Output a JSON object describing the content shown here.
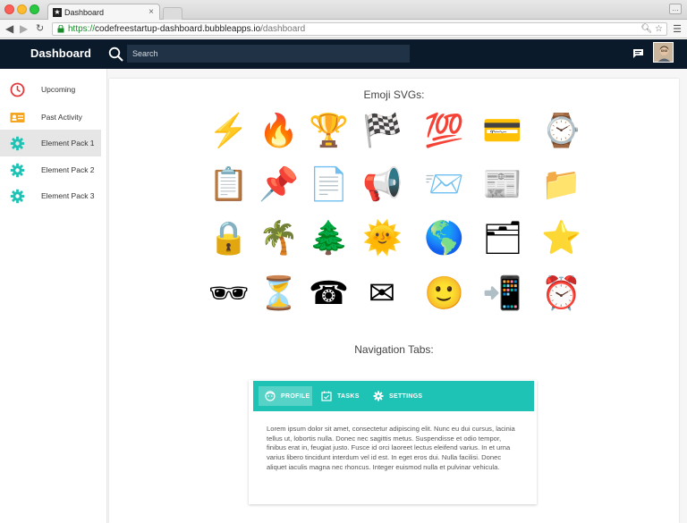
{
  "browser": {
    "tab_title": "Dashboard",
    "tab_close": "×",
    "url_scheme": "https://",
    "url_host": "codefreestartup-dashboard.bubbleapps.io",
    "url_path": "/dashboard"
  },
  "header": {
    "brand": "Dashboard",
    "search_placeholder": "Search"
  },
  "sidebar": {
    "items": [
      {
        "label": "Upcoming",
        "icon": "clock-icon",
        "color": "#e0393e"
      },
      {
        "label": "Past Activity",
        "icon": "id-card-icon",
        "color": "#f4a623"
      },
      {
        "label": "Element Pack 1",
        "icon": "gear-icon",
        "color": "#1ec3b5"
      },
      {
        "label": "Element Pack 2",
        "icon": "gear-icon",
        "color": "#1ec3b5"
      },
      {
        "label": "Element Pack 3",
        "icon": "gear-icon",
        "color": "#1ec3b5"
      }
    ]
  },
  "main": {
    "emoji_title": "Emoji SVGs:",
    "emojis": [
      {
        "glyph": "⚡",
        "name": "lightning-icon"
      },
      {
        "glyph": "🔥",
        "name": "fire-icon"
      },
      {
        "glyph": "🏆",
        "name": "trophy-icon"
      },
      {
        "glyph": "🏁",
        "name": "checkered-flag-icon"
      },
      {
        "glyph": "💯",
        "name": "hundred-points-icon"
      },
      {
        "glyph": "💳",
        "name": "credit-card-icon"
      },
      {
        "glyph": "⌚",
        "name": "watch-icon"
      },
      {
        "glyph": "📋",
        "name": "clipboard-icon"
      },
      {
        "glyph": "📌",
        "name": "pushpin-icon"
      },
      {
        "glyph": "📄",
        "name": "document-icon"
      },
      {
        "glyph": "📢",
        "name": "megaphone-icon"
      },
      {
        "glyph": "📨",
        "name": "incoming-envelope-icon"
      },
      {
        "glyph": "📰",
        "name": "newspaper-icon"
      },
      {
        "glyph": "📁",
        "name": "folder-icon"
      },
      {
        "glyph": "🔒",
        "name": "lock-icon"
      },
      {
        "glyph": "🌴",
        "name": "palm-tree-icon"
      },
      {
        "glyph": "🌲",
        "name": "evergreen-tree-icon"
      },
      {
        "glyph": "🌞",
        "name": "sun-icon"
      },
      {
        "glyph": "🌎",
        "name": "globe-icon"
      },
      {
        "glyph": "🗂",
        "name": "card-box-icon"
      },
      {
        "glyph": "⭐",
        "name": "star-icon"
      },
      {
        "glyph": "🕶",
        "name": "sunglasses-icon"
      },
      {
        "glyph": "⏳",
        "name": "hourglass-icon"
      },
      {
        "glyph": "☎",
        "name": "telephone-icon"
      },
      {
        "glyph": "✉",
        "name": "envelope-icon"
      },
      {
        "glyph": "🙂",
        "name": "smiley-icon"
      },
      {
        "glyph": "📲",
        "name": "mobile-arrow-icon"
      },
      {
        "glyph": "⏰",
        "name": "alarm-clock-icon"
      }
    ],
    "tabs_title": "Navigation Tabs:",
    "tabs": [
      {
        "label": "PROFILE",
        "icon": "face-icon",
        "active": true
      },
      {
        "label": "TASKS",
        "icon": "calendar-check-icon",
        "active": false
      },
      {
        "label": "SETTINGS",
        "icon": "gear-icon",
        "active": false
      }
    ],
    "tab_body": "Lorem ipsum dolor sit amet, consectetur adipiscing elit. Nunc eu dui cursus, lacinia tellus ut, lobortis nulla. Donec nec sagittis metus. Suspendisse et odio tempor, finibus erat in, feugiat justo. Fusce id orci laoreet lectus eleifend varius. In et urna varius libero tincidunt interdum vel id est. In eget eros dui. Nulla facilisi. Donec aliquet iaculis magna nec rhoncus. Integer euismod nulla et pulvinar vehicula."
  },
  "colors": {
    "header_bg": "#0a1a2b",
    "accent": "#1ec3b5",
    "sidebar_active": "#e6e6e6"
  }
}
